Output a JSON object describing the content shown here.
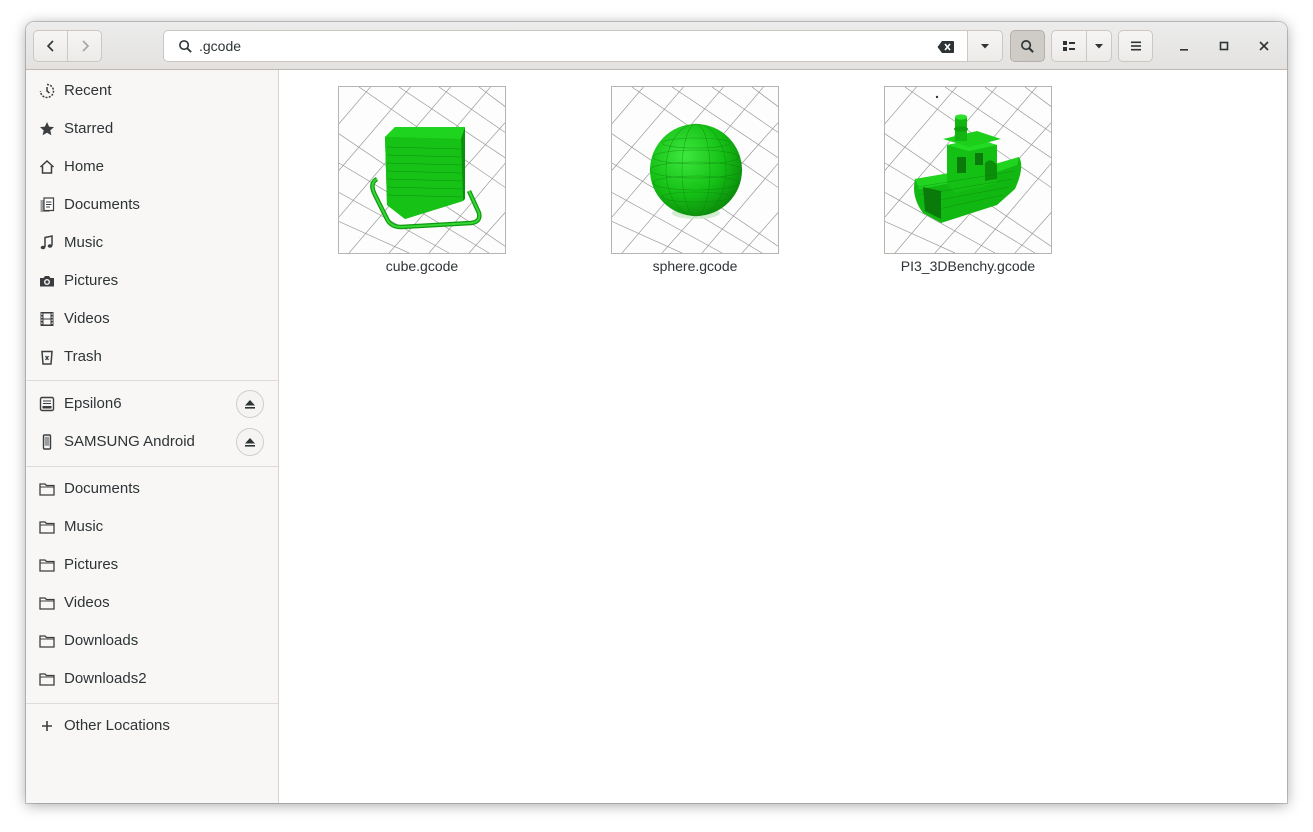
{
  "header": {
    "search_query": ".gcode",
    "icons": {
      "back": "go-previous-icon",
      "forward": "go-next-icon",
      "search": "search-icon",
      "clear": "edit-clear-icon",
      "dropdown": "pan-down-icon",
      "view_list": "view-list-icon",
      "menu": "open-menu-icon",
      "minimize": "window-minimize-icon",
      "maximize": "window-maximize-icon",
      "close": "window-close-icon"
    }
  },
  "sidebar": {
    "places": [
      {
        "label": "Recent",
        "icon": "recent-icon"
      },
      {
        "label": "Starred",
        "icon": "star-icon"
      },
      {
        "label": "Home",
        "icon": "home-icon"
      },
      {
        "label": "Documents",
        "icon": "documents-icon"
      },
      {
        "label": "Music",
        "icon": "music-icon"
      },
      {
        "label": "Pictures",
        "icon": "camera-icon"
      },
      {
        "label": "Videos",
        "icon": "film-icon"
      },
      {
        "label": "Trash",
        "icon": "trash-icon"
      }
    ],
    "devices": [
      {
        "label": "Epsilon6",
        "icon": "drive-icon"
      },
      {
        "label": "SAMSUNG Android",
        "icon": "phone-icon"
      }
    ],
    "bookmarks": [
      {
        "label": "Documents",
        "icon": "folder-icon"
      },
      {
        "label": "Music",
        "icon": "folder-icon"
      },
      {
        "label": "Pictures",
        "icon": "folder-icon"
      },
      {
        "label": "Videos",
        "icon": "folder-icon"
      },
      {
        "label": "Downloads",
        "icon": "folder-icon"
      },
      {
        "label": "Downloads2",
        "icon": "folder-icon"
      }
    ],
    "other_locations": {
      "label": "Other Locations",
      "icon": "plus-icon"
    }
  },
  "files": [
    {
      "name": "cube.gcode",
      "thumbnail": "green cube on grid"
    },
    {
      "name": "sphere.gcode",
      "thumbnail": "green sphere on grid"
    },
    {
      "name": "PI3_3DBenchy.gcode",
      "thumbnail": "green benchy boat on grid"
    }
  ],
  "colors": {
    "model_green": "#13c513",
    "headerbar": "#e8e6e3",
    "sidebar": "#f8f7f6"
  }
}
